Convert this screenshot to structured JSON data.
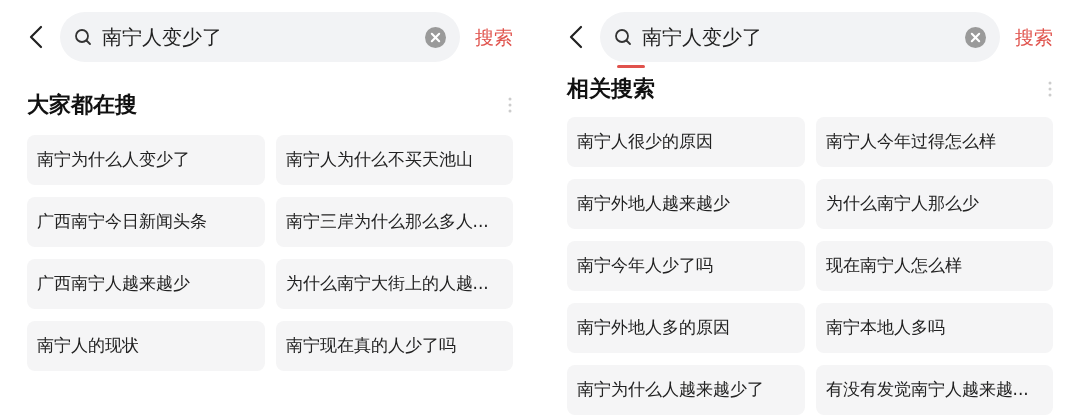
{
  "panels": [
    {
      "kind": "suggestions",
      "query": "南宁人变少了",
      "search_button": "搜索",
      "heading": "大家都在搜",
      "items": [
        "南宁为什么人变少了",
        "南宁人为什么不买天池山",
        "广西南宁今日新闻头条",
        "南宁三岸为什么那么多人...",
        "广西南宁人越来越少",
        "为什么南宁大街上的人越...",
        "南宁人的现状",
        "南宁现在真的人少了吗"
      ]
    },
    {
      "kind": "related",
      "query": "南宁人变少了",
      "search_button": "搜索",
      "heading": "相关搜索",
      "items": [
        "南宁人很少的原因",
        "南宁人今年过得怎么样",
        "南宁外地人越来越少",
        "为什么南宁人那么少",
        "南宁今年人少了吗",
        "现在南宁人怎么样",
        "南宁外地人多的原因",
        "南宁本地人多吗",
        "南宁为什么人越来越少了",
        "有没有发觉南宁人越来越..."
      ]
    }
  ]
}
